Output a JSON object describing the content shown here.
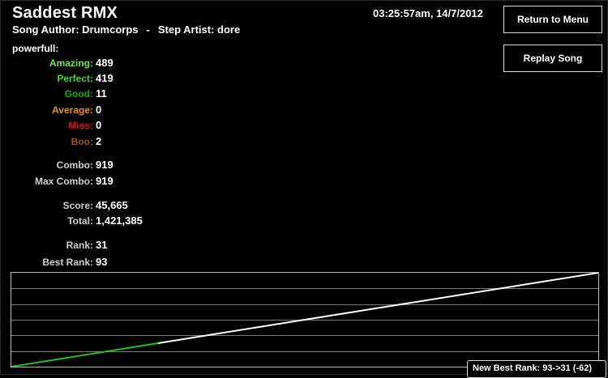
{
  "song": {
    "title": "Saddest RMX",
    "author_label": "Song Author: Drumcorps",
    "separator": "-",
    "artist_label": "Step Artist: dore",
    "datetime": "03:25:57am, 14/7/2012"
  },
  "buttons": {
    "return_menu": "Return to Menu",
    "replay_song": "Replay Song"
  },
  "player": {
    "name": "powerfull:"
  },
  "judgements": [
    {
      "label": "Amazing:",
      "value": "489",
      "color": "#6ee64a"
    },
    {
      "label": "Perfect:",
      "value": "419",
      "color": "#39d821"
    },
    {
      "label": "Good:",
      "value": "11",
      "color": "#16a816"
    },
    {
      "label": "Average:",
      "value": "0",
      "color": "#e8921a"
    },
    {
      "label": "Miss:",
      "value": "0",
      "color": "#e01010"
    },
    {
      "label": "Boo:",
      "value": "2",
      "color": "#a0521a"
    }
  ],
  "combo": {
    "combo_label": "Combo:",
    "combo_value": "919",
    "max_label": "Max Combo:",
    "max_value": "919"
  },
  "score": {
    "score_label": "Score:",
    "score_value": "45,665",
    "total_label": "Total:",
    "total_value": "1,421,385"
  },
  "rank": {
    "rank_label": "Rank:",
    "rank_value": "31",
    "best_label": "Best Rank:",
    "best_value": "93"
  },
  "notification": {
    "text": "New Best Rank: 93->31 (-62)"
  },
  "colors": {
    "label": "#cfcfcf",
    "graph_green": "#22c01a",
    "graph_white": "#ffffff",
    "grid": "#7a7a7a"
  },
  "chart_data": {
    "type": "line",
    "x": [
      0,
      0.25,
      1
    ],
    "y": [
      0,
      0.25,
      1
    ],
    "green_until": 0.25,
    "xlim": [
      0,
      1
    ],
    "ylim": [
      0,
      1
    ],
    "grid_rows": 6,
    "grid": true
  }
}
